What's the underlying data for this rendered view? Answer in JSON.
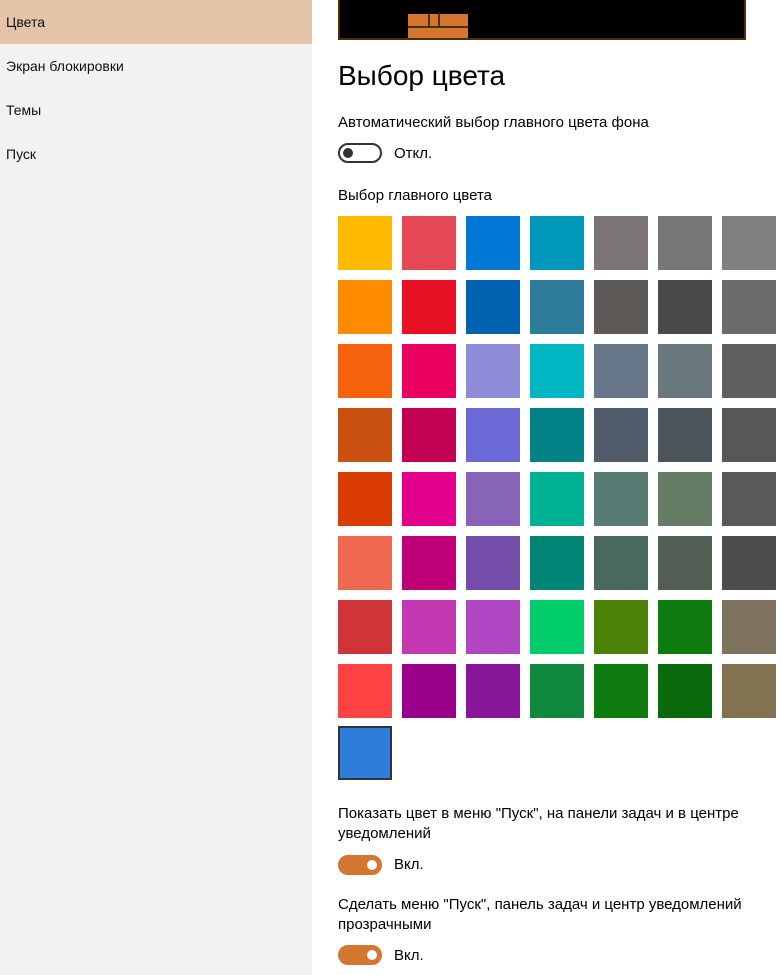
{
  "sidebar": {
    "items": [
      {
        "label": "Цвета",
        "active": true
      },
      {
        "label": "Экран блокировки",
        "active": false
      },
      {
        "label": "Темы",
        "active": false
      },
      {
        "label": "Пуск",
        "active": false
      }
    ]
  },
  "main": {
    "heading": "Выбор цвета",
    "autoColor": {
      "label": "Автоматический выбор главного цвета фона",
      "state": "Откл.",
      "on": false
    },
    "pickLabel": "Выбор главного цвета",
    "colors": [
      "#ffb900",
      "#e74856",
      "#0078d7",
      "#0099bc",
      "#7a7574",
      "#767676",
      "#808080",
      "#ff8c00",
      "#e81123",
      "#0063b1",
      "#2d7d9a",
      "#5d5a58",
      "#4c4a48",
      "#6b6b6b",
      "#f7630c",
      "#ea005e",
      "#8e8cd8",
      "#00b7c3",
      "#68768a",
      "#69797e",
      "#5f5f5f",
      "#ca5010",
      "#c30052",
      "#6b69d6",
      "#038387",
      "#515c6b",
      "#4a5459",
      "#575757",
      "#da3b01",
      "#e3008c",
      "#8764b8",
      "#00b294",
      "#567c73",
      "#647c64",
      "#595959",
      "#ef6950",
      "#bf0077",
      "#744da9",
      "#018574",
      "#486860",
      "#525e54",
      "#4d4d4d",
      "#d13438",
      "#c239b3",
      "#b146c2",
      "#00cc6a",
      "#498205",
      "#107c10",
      "#7e735f",
      "#ff4343",
      "#9a0089",
      "#881798",
      "#10893e",
      "#107c10",
      "#0b6a0b",
      "#827252"
    ],
    "selectedColor": "#2f7ddb",
    "showColor": {
      "label": "Показать цвет в меню \"Пуск\", на панели задач и в центре уведомлений",
      "state": "Вкл.",
      "on": true
    },
    "transparency": {
      "label": "Сделать меню \"Пуск\", панель задач и центр уведомлений прозрачными",
      "state": "Вкл.",
      "on": true
    }
  }
}
